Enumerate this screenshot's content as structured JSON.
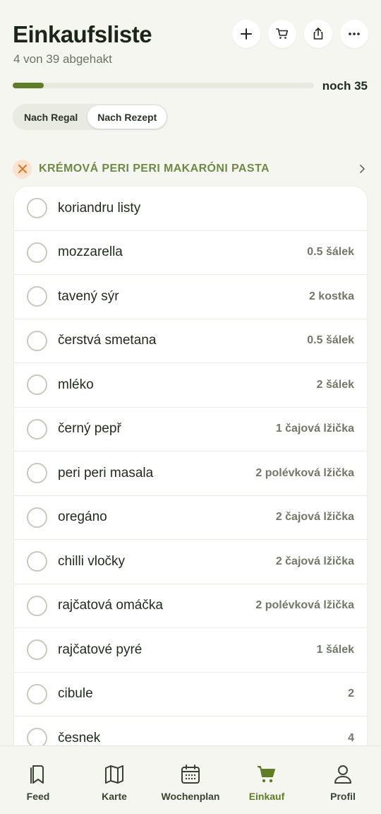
{
  "header": {
    "title": "Einkaufsliste",
    "subtitle": "4 von 39 abgehakt"
  },
  "progress": {
    "fraction": 0.1026,
    "remaining_label": "noch 35"
  },
  "segmented": {
    "options": [
      "Nach Regal",
      "Nach Rezept"
    ],
    "selected": "Nach Rezept"
  },
  "recipe": {
    "title": "KRÉMOVÁ PERI PERI MAKARÓNI PASTA",
    "icon": "utensils-crossed-icon"
  },
  "items": [
    {
      "name": "koriandru listy",
      "qty": ""
    },
    {
      "name": "mozzarella",
      "qty": "0.5 šálek"
    },
    {
      "name": "tavený sýr",
      "qty": "2 kostka"
    },
    {
      "name": "čerstvá smetana",
      "qty": "0.5 šálek"
    },
    {
      "name": "mléko",
      "qty": "2 šálek"
    },
    {
      "name": "černý pepř",
      "qty": "1 čajová lžička"
    },
    {
      "name": "peri peri masala",
      "qty": "2 polévková lžička"
    },
    {
      "name": "oregáno",
      "qty": "2 čajová lžička"
    },
    {
      "name": "chilli vločky",
      "qty": "2 čajová lžička"
    },
    {
      "name": "rajčatová omáčka",
      "qty": "2 polévková lžička"
    },
    {
      "name": "rajčatové pyré",
      "qty": "1 šálek"
    },
    {
      "name": "cibule",
      "qty": "2"
    },
    {
      "name": "česnek",
      "qty": "4"
    }
  ],
  "tabs": [
    {
      "label": "Feed",
      "icon": "bookmark-icon"
    },
    {
      "label": "Karte",
      "icon": "map-icon"
    },
    {
      "label": "Wochenplan",
      "icon": "calendar-icon"
    },
    {
      "label": "Einkauf",
      "icon": "cart-icon"
    },
    {
      "label": "Profil",
      "icon": "user-icon"
    }
  ],
  "active_tab": "Einkauf",
  "colors": {
    "accent": "#5d7e24",
    "recipe_title": "#6f8a46",
    "background": "#f6f6f1"
  }
}
